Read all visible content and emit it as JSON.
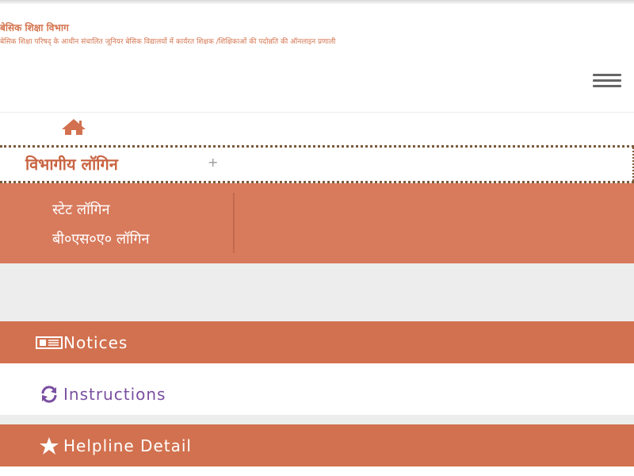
{
  "header": {
    "title": "बेसिक शिक्षा विभाग",
    "subtitle": "बेसिक शिक्षा परिषद् के आधीन संचालित जूनियर बेसिक विद्यालयों में कार्यरत शिक्षक /शिक्षिकाओं की पदोन्नति की ऑनलाइन प्रणाली"
  },
  "nav": {
    "home_icon": "home-icon",
    "menu_icon": "hamburger-menu-icon"
  },
  "dept_login": {
    "label": "विभागीय लॉगिन",
    "expand": "+",
    "items": [
      {
        "label": "स्टेट लॉगिन"
      },
      {
        "label": "बी०एस०ए० लॉगिन"
      }
    ]
  },
  "panels": {
    "notices": {
      "label": "Notices",
      "icon": "newspaper-icon"
    },
    "instructions": {
      "label": "Instructions",
      "icon": "refresh-icon"
    },
    "helpline": {
      "label": "Helpline Detail",
      "icon": "star-icon"
    }
  },
  "colors": {
    "accent": "#d2714f",
    "submenu": "#d87a5c",
    "instructions_text": "#7a4fa0"
  }
}
